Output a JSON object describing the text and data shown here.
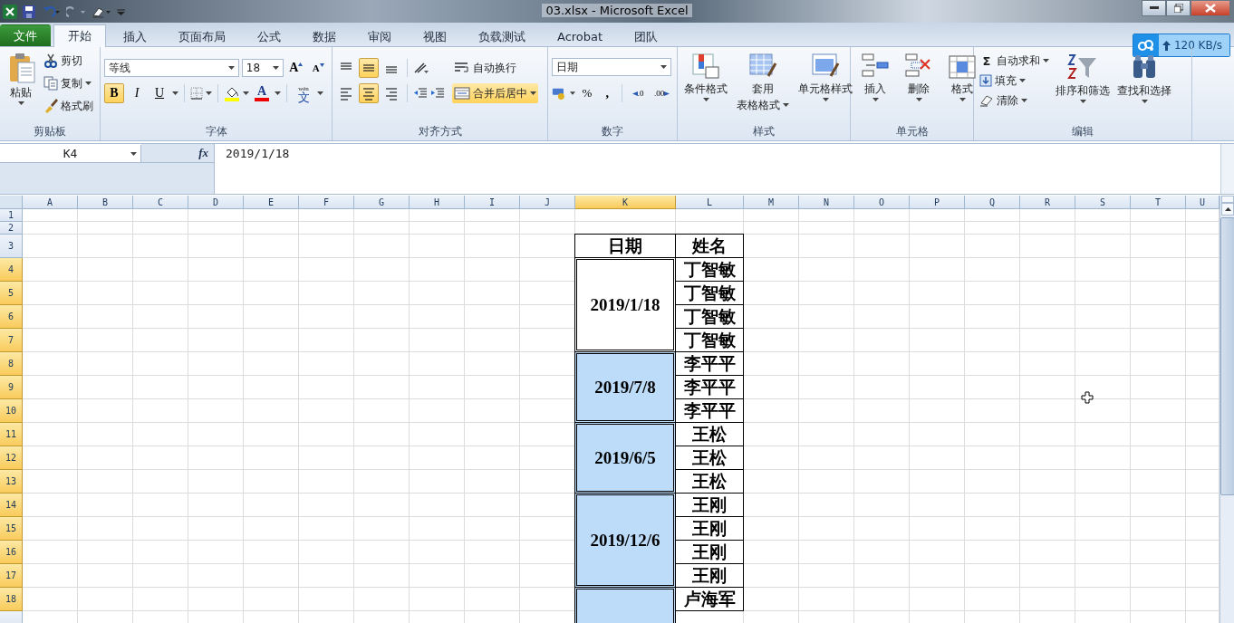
{
  "title_bar": {
    "title": "03.xlsx  -  Microsoft Excel"
  },
  "tabs": [
    {
      "label": "文件",
      "kind": "file",
      "selected": false
    },
    {
      "label": "开始",
      "kind": "tab",
      "selected": true
    },
    {
      "label": "插入",
      "kind": "tab",
      "selected": false
    },
    {
      "label": "页面布局",
      "kind": "tab",
      "selected": false
    },
    {
      "label": "公式",
      "kind": "tab",
      "selected": false
    },
    {
      "label": "数据",
      "kind": "tab",
      "selected": false
    },
    {
      "label": "审阅",
      "kind": "tab",
      "selected": false
    },
    {
      "label": "视图",
      "kind": "tab",
      "selected": false
    },
    {
      "label": "负载测试",
      "kind": "tab",
      "selected": false
    },
    {
      "label": "Acrobat",
      "kind": "tab",
      "selected": false
    },
    {
      "label": "团队",
      "kind": "tab",
      "selected": false
    }
  ],
  "upload_badge": {
    "speed": "120 KB/s"
  },
  "ribbon": {
    "clipboard": {
      "title": "剪贴板",
      "paste": "粘贴",
      "cut": "剪切",
      "copy": "复制",
      "format_painter": "格式刷"
    },
    "font": {
      "title": "字体",
      "font_name": "等线",
      "font_size": "18",
      "grow_label": "A",
      "shrink_label": "A",
      "bold_label": "B",
      "italic_label": "I",
      "underline_label": "U",
      "bold": true,
      "italic": false,
      "underline": false,
      "font_color_label": "A",
      "phonetic_label": "文",
      "phonetic_ruby": "wén"
    },
    "alignment": {
      "title": "对齐方式",
      "wrap_text": "自动换行",
      "merge_center": "合并后居中",
      "merge_on": true,
      "middle_align": true,
      "center_align": true
    },
    "number": {
      "title": "数字",
      "format": "日期",
      "percent": "%",
      "comma": ",",
      "increase_decimal": ".0",
      "decrease_decimal": ".00"
    },
    "styles": {
      "title": "样式",
      "conditional": "条件格式",
      "table_format_1": "套用",
      "table_format_2": "表格格式",
      "cell_styles": "单元格样式"
    },
    "cells": {
      "title": "单元格",
      "insert": "插入",
      "delete": "删除",
      "format": "格式"
    },
    "editing": {
      "title": "编辑",
      "autosum_symbol": "Σ",
      "autosum": "自动求和",
      "fill": "填充",
      "clear": "清除",
      "sort_filter": "排序和筛选",
      "find_select": "查找和选择"
    }
  },
  "formula_bar": {
    "name_box": "K4",
    "fx_label": "fx",
    "value": "2019/1/18"
  },
  "sheet": {
    "columns": [
      {
        "label": "A",
        "selected": false
      },
      {
        "label": "B",
        "selected": false
      },
      {
        "label": "C",
        "selected": false
      },
      {
        "label": "D",
        "selected": false
      },
      {
        "label": "E",
        "selected": false
      },
      {
        "label": "F",
        "selected": false
      },
      {
        "label": "G",
        "selected": false
      },
      {
        "label": "H",
        "selected": false
      },
      {
        "label": "I",
        "selected": false
      },
      {
        "label": "J",
        "selected": false
      },
      {
        "label": "K",
        "selected": true
      },
      {
        "label": "L",
        "selected": false
      },
      {
        "label": "M",
        "selected": false
      },
      {
        "label": "N",
        "selected": false
      },
      {
        "label": "O",
        "selected": false
      },
      {
        "label": "P",
        "selected": false
      },
      {
        "label": "Q",
        "selected": false
      },
      {
        "label": "R",
        "selected": false
      },
      {
        "label": "S",
        "selected": false
      },
      {
        "label": "T",
        "selected": false
      },
      {
        "label": "U",
        "selected": false
      }
    ],
    "rows": [
      {
        "label": "1",
        "selected": false
      },
      {
        "label": "2",
        "selected": false
      },
      {
        "label": "3",
        "selected": false
      },
      {
        "label": "4",
        "selected": true
      },
      {
        "label": "5",
        "selected": true
      },
      {
        "label": "6",
        "selected": true
      },
      {
        "label": "7",
        "selected": true
      },
      {
        "label": "8",
        "selected": true
      },
      {
        "label": "9",
        "selected": true
      },
      {
        "label": "10",
        "selected": true
      },
      {
        "label": "11",
        "selected": true
      },
      {
        "label": "12",
        "selected": true
      },
      {
        "label": "13",
        "selected": true
      },
      {
        "label": "14",
        "selected": true
      },
      {
        "label": "15",
        "selected": true
      },
      {
        "label": "16",
        "selected": true
      },
      {
        "label": "17",
        "selected": true
      },
      {
        "label": "18",
        "selected": true
      }
    ],
    "table": {
      "headers": [
        "日期",
        "姓名"
      ],
      "groups": [
        {
          "date": "2019/1/18",
          "highlighted": false,
          "names": [
            "丁智敏",
            "丁智敏",
            "丁智敏",
            "丁智敏"
          ]
        },
        {
          "date": "2019/7/8",
          "highlighted": true,
          "names": [
            "李平平",
            "李平平",
            "李平平"
          ]
        },
        {
          "date": "2019/6/5",
          "highlighted": true,
          "names": [
            "王松",
            "王松",
            "王松"
          ]
        },
        {
          "date": "2019/12/6",
          "highlighted": true,
          "names": [
            "王刚",
            "王刚",
            "王刚",
            "王刚"
          ]
        },
        {
          "highlighted": true,
          "names": [
            "卢海军"
          ]
        }
      ]
    }
  }
}
